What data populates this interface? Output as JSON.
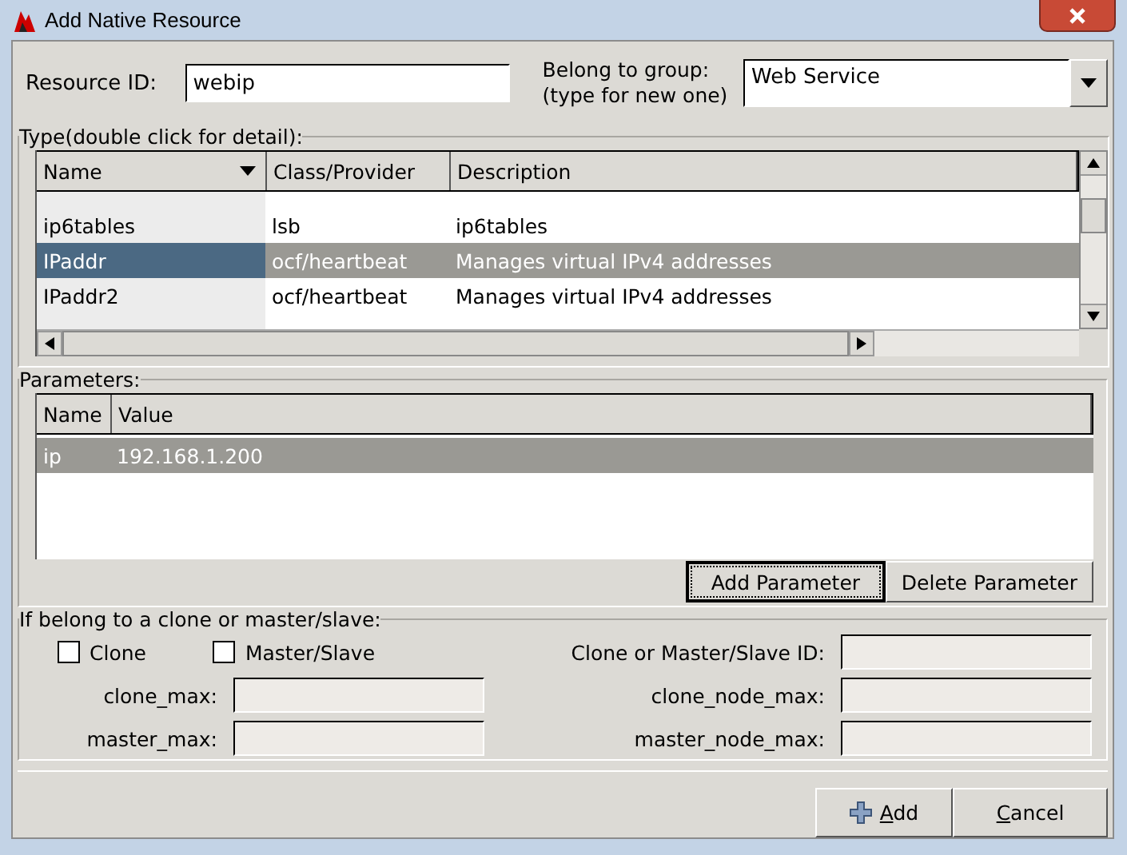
{
  "window": {
    "title": "Add Native Resource"
  },
  "resource_id": {
    "label": "Resource ID:",
    "value": "webip"
  },
  "group": {
    "label": "Belong to group:",
    "hint": "(type for new one)",
    "value": "Web Service"
  },
  "type_panel": {
    "title": "Type(double click for detail):",
    "columns": [
      "Name",
      "Class/Provider",
      "Description"
    ],
    "rows": [
      {
        "name": "ip6tables",
        "provider": "lsb",
        "description": "ip6tables",
        "selected": false
      },
      {
        "name": "IPaddr",
        "provider": "ocf/heartbeat",
        "description": "Manages virtual IPv4 addresses",
        "selected": true
      },
      {
        "name": "IPaddr2",
        "provider": "ocf/heartbeat",
        "description": "Manages virtual IPv4 addresses",
        "selected": false
      }
    ]
  },
  "parameters": {
    "title": "Parameters:",
    "columns": [
      "Name",
      "Value"
    ],
    "rows": [
      {
        "name": "ip",
        "value": "192.168.1.200",
        "selected": true
      }
    ],
    "buttons": [
      "Add Parameter",
      "Delete Parameter"
    ]
  },
  "clone_panel": {
    "title": "If belong to a clone or master/slave:",
    "checkboxes": [
      {
        "label": "Clone",
        "checked": false
      },
      {
        "label": "Master/Slave",
        "checked": false
      }
    ],
    "id_label": "Clone or Master/Slave ID:",
    "fields": [
      {
        "label": "clone_max:"
      },
      {
        "label": "clone_node_max:"
      },
      {
        "label": "master_max:"
      },
      {
        "label": "master_node_max:"
      }
    ]
  },
  "buttons": [
    {
      "kind": "add",
      "label": "Add"
    },
    {
      "kind": "cancel",
      "label": "Cancel"
    }
  ]
}
